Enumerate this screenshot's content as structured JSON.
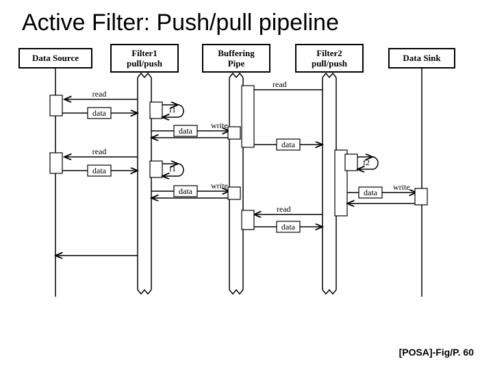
{
  "title": "Active Filter: Push/pull pipeline",
  "citation": "[POSA]-Fig/P. 60",
  "lifelines": {
    "dataSource": "Data Source",
    "filter1a": "Filter1",
    "filter1b": "pull/push",
    "bufferA": "Buffering",
    "bufferB": "Pipe",
    "filter2a": "Filter2",
    "filter2b": "pull/push",
    "dataSink": "Data Sink"
  },
  "labels": {
    "read": "read",
    "data": "data",
    "write": "write",
    "f1": "f1",
    "f2": "f2"
  }
}
